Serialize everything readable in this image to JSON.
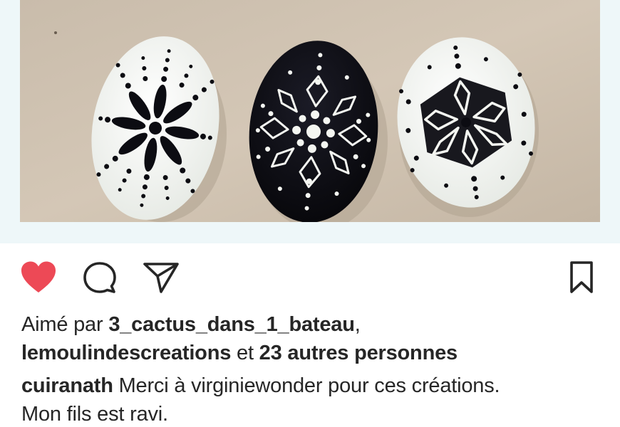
{
  "post": {
    "liked_by_prefix": "Aimé par",
    "liked_user_1": "3_cactus_dans_1_bateau",
    "comma": ",",
    "liked_user_2": "lemoulindescreations",
    "and_word": "et",
    "others_text": "23 autres personnes",
    "caption_author": "cuiranath",
    "caption_line_1": "Merci à virginiewonder pour ces créations.",
    "caption_line_2": "Mon fils est ravi."
  },
  "icons": {
    "like": "heart-filled-icon",
    "comment": "comment-bubble-icon",
    "share": "paper-plane-icon",
    "save": "bookmark-icon"
  },
  "colors": {
    "like_red": "#ed4956",
    "text": "#262626",
    "frame": "#eef7f9",
    "stone_dark": "#0c0c12",
    "stone_light": "#f4f6f1",
    "table": "#cdbfae"
  }
}
